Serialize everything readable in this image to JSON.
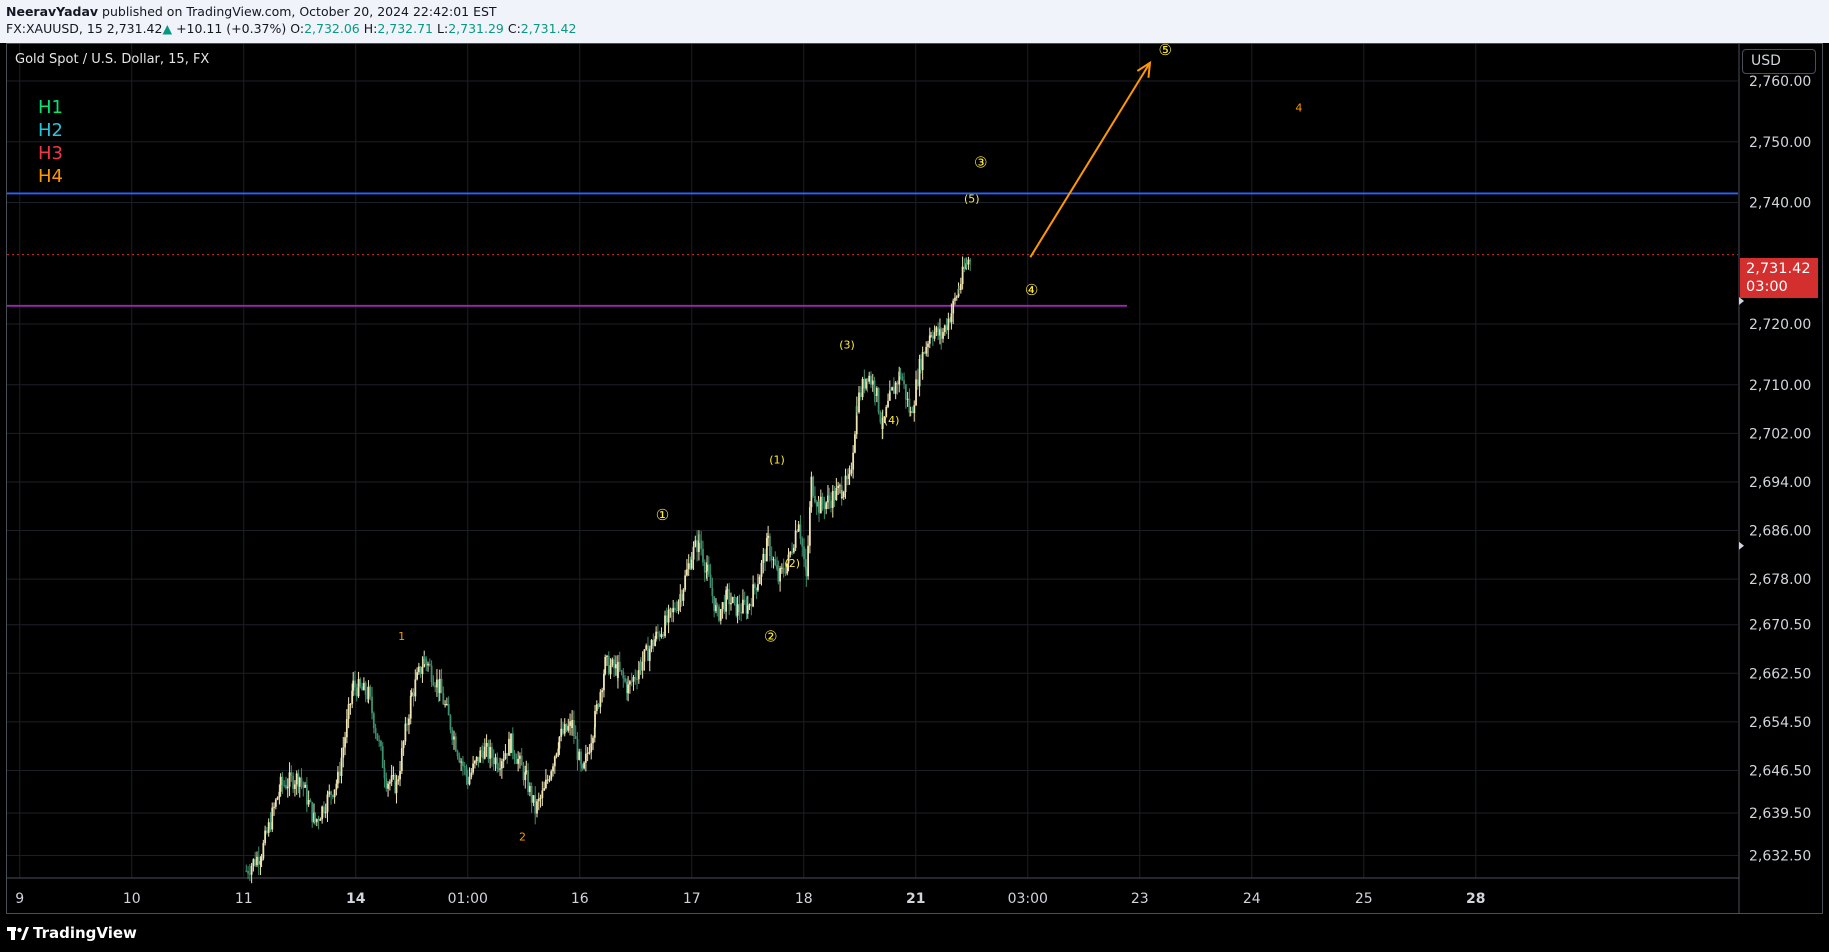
{
  "header": {
    "publisher": "NeeravYadav",
    "published_text": "published on TradingView.com, October 20, 2024 22:42:01 EST",
    "symbol": "FX:XAUUSD, 15",
    "last": "2,731.42",
    "change_arrow": "▲",
    "change": "+10.11 (+0.37%)",
    "o_label": "O:",
    "o": "2,732.06",
    "h_label": "H:",
    "h": "2,732.71",
    "l_label": "L:",
    "l": "2,731.29",
    "c_label": "C:",
    "c": "2,731.42"
  },
  "chart_title": "Gold Spot / U.S. Dollar, 15, FX",
  "legend": [
    {
      "label": "H1",
      "color": "#00e676"
    },
    {
      "label": "H2",
      "color": "#26c6da"
    },
    {
      "label": "H3",
      "color": "#f23645"
    },
    {
      "label": "H4",
      "color": "#ff9800"
    }
  ],
  "currency_button": "USD",
  "last_price_tag": {
    "price": "2,731.42",
    "countdown": "03:00",
    "color": "#d32f2f"
  },
  "footer": {
    "brand": "TradingView",
    "logo_icon": "tradingview-logo-icon"
  },
  "colors": {
    "background": "#000000",
    "grid": "#1c1f26",
    "up_candle": "#f0e6b4",
    "down_candle": "#3d8f6e",
    "blue_level": "#2962ff",
    "purple_level": "#9c27b0",
    "arrow": "#ff9800",
    "wave_label": "#ffeb3b",
    "subwave_label": "#ff9800"
  },
  "chart_data": {
    "type": "candlestick",
    "title": "Gold Spot / U.S. Dollar, 15, FX",
    "y_range": [
      2628.8,
      2766.1
    ],
    "y_ticks": [
      {
        "value": 2760.0,
        "label": "2,760.00"
      },
      {
        "value": 2750.0,
        "label": "2,750.00"
      },
      {
        "value": 2740.0,
        "label": "2,740.00"
      },
      {
        "value": 2731.42,
        "label": "2,731.42"
      },
      {
        "value": 2720.0,
        "label": "2,720.00"
      },
      {
        "value": 2710.0,
        "label": "2,710.00"
      },
      {
        "value": 2702.0,
        "label": "2,702.00"
      },
      {
        "value": 2694.0,
        "label": "2,694.00"
      },
      {
        "value": 2686.0,
        "label": "2,686.00"
      },
      {
        "value": 2678.0,
        "label": "2,678.00"
      },
      {
        "value": 2670.5,
        "label": "2,670.50"
      },
      {
        "value": 2662.5,
        "label": "2,662.50"
      },
      {
        "value": 2654.5,
        "label": "2,654.50"
      },
      {
        "value": 2646.5,
        "label": "2,646.50"
      },
      {
        "value": 2639.5,
        "label": "2,639.50"
      },
      {
        "value": 2632.5,
        "label": "2,632.50"
      }
    ],
    "x_ticks": [
      {
        "t": 0.0,
        "label": "9",
        "bold": false
      },
      {
        "t": 0.088,
        "label": "10",
        "bold": false
      },
      {
        "t": 0.176,
        "label": "11",
        "bold": false
      },
      {
        "t": 0.264,
        "label": "14",
        "bold": true
      },
      {
        "t": 0.352,
        "label": "01:00",
        "bold": false
      },
      {
        "t": 0.44,
        "label": "16",
        "bold": false
      },
      {
        "t": 0.528,
        "label": "17",
        "bold": false
      },
      {
        "t": 0.616,
        "label": "18",
        "bold": false
      },
      {
        "t": 0.704,
        "label": "21",
        "bold": true
      },
      {
        "t": 0.792,
        "label": "03:00",
        "bold": false
      },
      {
        "t": 0.88,
        "label": "23",
        "bold": false
      },
      {
        "t": 0.968,
        "label": "24",
        "bold": false
      },
      {
        "t": 1.056,
        "label": "25",
        "bold": false
      },
      {
        "t": 1.144,
        "label": "28",
        "bold": true
      }
    ],
    "x_range_units": [
      -0.01,
      1.35
    ],
    "price_path": [
      [
        0.178,
        2630.0
      ],
      [
        0.19,
        2633.0
      ],
      [
        0.205,
        2644.0
      ],
      [
        0.22,
        2645.5
      ],
      [
        0.232,
        2638.0
      ],
      [
        0.25,
        2645.0
      ],
      [
        0.262,
        2660.5
      ],
      [
        0.274,
        2659.0
      ],
      [
        0.288,
        2645.0
      ],
      [
        0.296,
        2644.0
      ],
      [
        0.308,
        2659.0
      ],
      [
        0.318,
        2665.0
      ],
      [
        0.33,
        2660.0
      ],
      [
        0.344,
        2650.0
      ],
      [
        0.352,
        2645.0
      ],
      [
        0.364,
        2650.0
      ],
      [
        0.376,
        2648.0
      ],
      [
        0.386,
        2651.0
      ],
      [
        0.398,
        2645.0
      ],
      [
        0.405,
        2640.0
      ],
      [
        0.412,
        2643.0
      ],
      [
        0.424,
        2652.0
      ],
      [
        0.434,
        2654.0
      ],
      [
        0.442,
        2645.5
      ],
      [
        0.452,
        2655.0
      ],
      [
        0.46,
        2664.0
      ],
      [
        0.47,
        2663.0
      ],
      [
        0.478,
        2660.0
      ],
      [
        0.488,
        2664.0
      ],
      [
        0.5,
        2668.5
      ],
      [
        0.512,
        2672.0
      ],
      [
        0.52,
        2676.0
      ],
      [
        0.528,
        2682.0
      ],
      [
        0.534,
        2684.5
      ],
      [
        0.54,
        2679.0
      ],
      [
        0.548,
        2672.0
      ],
      [
        0.556,
        2675.0
      ],
      [
        0.564,
        2673.0
      ],
      [
        0.572,
        2673.5
      ],
      [
        0.58,
        2678.0
      ],
      [
        0.588,
        2684.0
      ],
      [
        0.596,
        2678.0
      ],
      [
        0.604,
        2681.0
      ],
      [
        0.612,
        2688.0
      ],
      [
        0.618,
        2678.0
      ],
      [
        0.622,
        2694.0
      ],
      [
        0.628,
        2690.0
      ],
      [
        0.636,
        2691.0
      ],
      [
        0.646,
        2693.0
      ],
      [
        0.652,
        2694.0
      ],
      [
        0.658,
        2707.0
      ],
      [
        0.666,
        2712.0
      ],
      [
        0.672,
        2709.5
      ],
      [
        0.678,
        2703.0
      ],
      [
        0.684,
        2708.0
      ],
      [
        0.692,
        2712.0
      ],
      [
        0.7,
        2705.0
      ],
      [
        0.708,
        2714.0
      ],
      [
        0.716,
        2719.0
      ],
      [
        0.724,
        2718.0
      ],
      [
        0.732,
        2722.0
      ],
      [
        0.738,
        2726.0
      ],
      [
        0.744,
        2730.0
      ],
      [
        0.748,
        2731.42
      ]
    ],
    "horizontal_levels": [
      {
        "price": 2741.5,
        "color": "#2962ff",
        "extends": "full"
      },
      {
        "price": 2723.0,
        "color": "#9c27b0",
        "extends": "partial",
        "x_end": 0.87
      },
      {
        "price": 2731.42,
        "color": "#d32f2f",
        "style": "dotted",
        "extends": "full"
      }
    ],
    "projection_arrow": {
      "from": [
        0.794,
        2731.0
      ],
      "to": [
        0.888,
        2763.0
      ],
      "color": "#ff9800"
    },
    "wave_labels": [
      {
        "text": "1",
        "circled": false,
        "color": "#ff9800",
        "x": 0.3,
        "price": 2668.5
      },
      {
        "text": "2",
        "circled": false,
        "color": "#ff9800",
        "x": 0.395,
        "price": 2635.5
      },
      {
        "text": "①",
        "circled": true,
        "color": "#ffeb3b",
        "x": 0.505,
        "price": 2688.5
      },
      {
        "text": "②",
        "circled": true,
        "color": "#ffeb3b",
        "x": 0.59,
        "price": 2668.5
      },
      {
        "text": "(1)",
        "circled": false,
        "color": "#ffeb3b",
        "x": 0.595,
        "price": 2697.5
      },
      {
        "text": "(2)",
        "circled": false,
        "color": "#ffeb3b",
        "x": 0.607,
        "price": 2680.5
      },
      {
        "text": "(3)",
        "circled": false,
        "color": "#ffeb3b",
        "x": 0.65,
        "price": 2716.5
      },
      {
        "text": "(4)",
        "circled": false,
        "color": "#ffeb3b",
        "x": 0.685,
        "price": 2704.0
      },
      {
        "text": "(5)",
        "circled": false,
        "color": "#ffeb3b",
        "x": 0.748,
        "price": 2740.5
      },
      {
        "text": "③",
        "circled": true,
        "color": "#ffeb3b",
        "x": 0.755,
        "price": 2746.5
      },
      {
        "text": "④",
        "circled": true,
        "color": "#ffeb3b",
        "x": 0.795,
        "price": 2725.5
      },
      {
        "text": "⑤",
        "circled": true,
        "color": "#ffeb3b",
        "x": 0.9,
        "price": 2765.0
      },
      {
        "text": "4",
        "circled": false,
        "color": "#ff9800",
        "x": 1.005,
        "price": 2755.5
      }
    ]
  }
}
